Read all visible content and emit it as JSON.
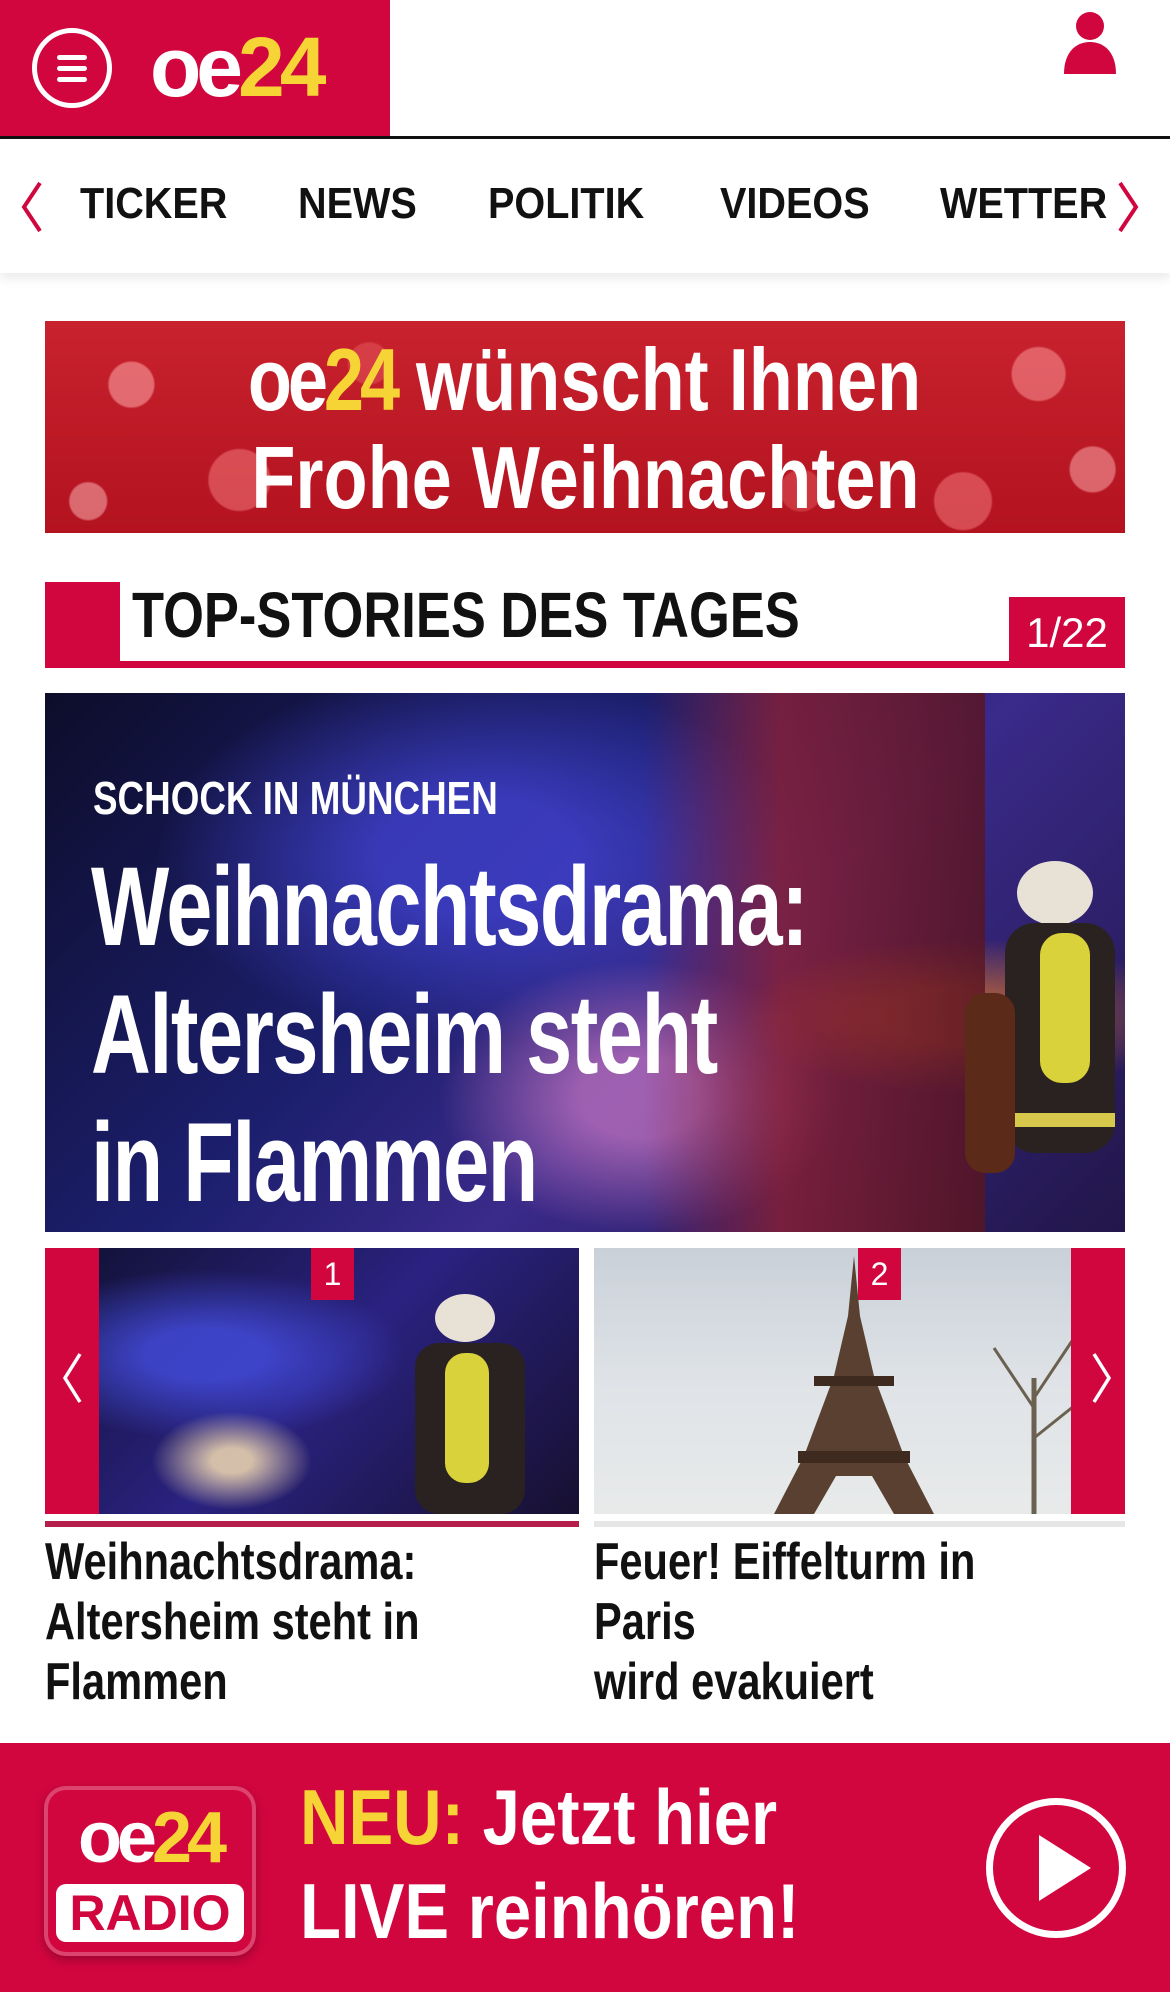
{
  "header": {
    "logo_oe": "oe",
    "logo_24": "24",
    "menu_icon": "hamburger-menu-icon",
    "user_icon": "user-icon"
  },
  "nav": {
    "items": [
      {
        "label": "TICKER"
      },
      {
        "label": "NEWS"
      },
      {
        "label": "POLITIK"
      },
      {
        "label": "VIDEOS"
      },
      {
        "label": "WETTER"
      }
    ],
    "left_arrow_icon": "chevron-left-icon",
    "right_arrow_icon": "chevron-right-icon"
  },
  "banner": {
    "logo_oe": "oe",
    "logo_24": "24",
    "line1_text": "wünscht Ihnen",
    "line2_text": "Frohe Weihnachten"
  },
  "section": {
    "title": "TOP-STORIES DES TAGES",
    "counter": "1/22"
  },
  "hero": {
    "kicker": "SCHOCK IN MÜNCHEN",
    "title_line1": "Weihnachtsdrama:",
    "title_line2": "Altersheim steht",
    "title_line3": "in Flammen"
  },
  "carousel": {
    "items": [
      {
        "number": "1",
        "caption_line1": "Weihnachtsdrama:",
        "caption_line2": "Altersheim steht in",
        "caption_line3": "Flammen"
      },
      {
        "number": "2",
        "caption_line1": "Feuer! Eiffelturm in Paris",
        "caption_line2": "wird evakuiert"
      }
    ]
  },
  "radio": {
    "logo_oe": "oe",
    "logo_24": "24",
    "logo_label": "RADIO",
    "neu_label": "NEU:",
    "line1_rest": " Jetzt hier",
    "line2": "LIVE reinhören!",
    "play_icon": "play-icon"
  },
  "colors": {
    "brand_red": "#d1063f",
    "brand_yellow": "#f6d435"
  }
}
